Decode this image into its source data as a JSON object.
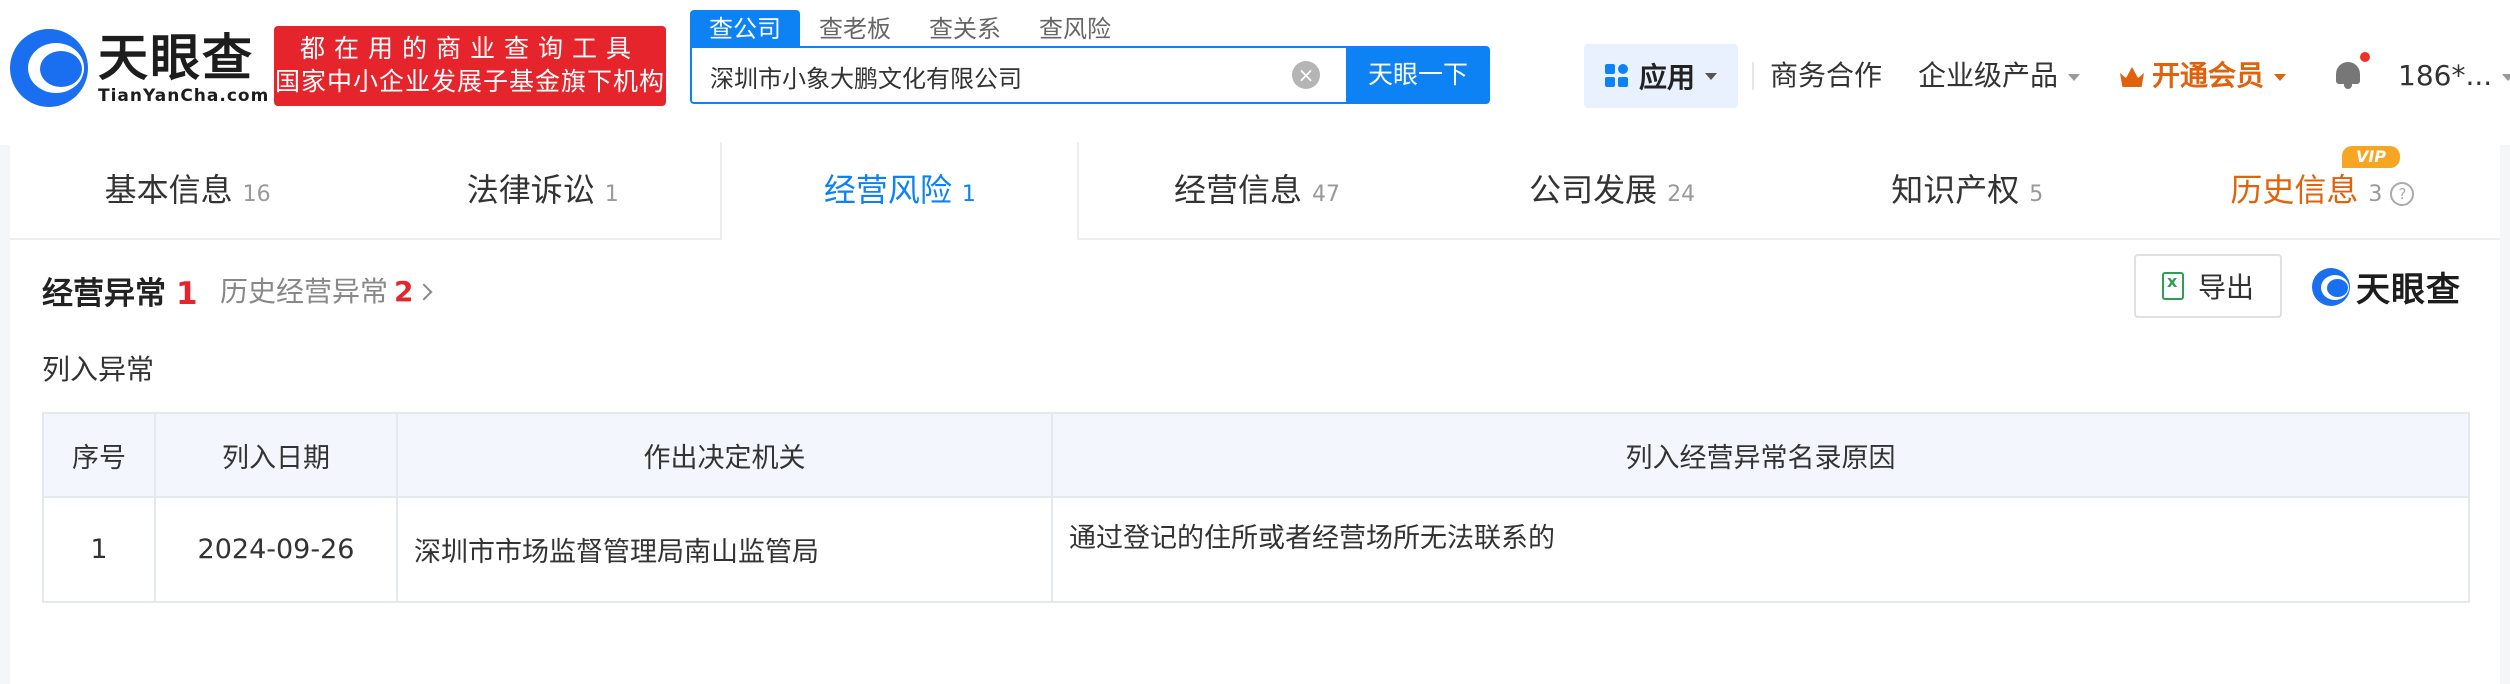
{
  "header": {
    "logo": {
      "cn": "天眼查",
      "en": "TianYanCha.com"
    },
    "promo": {
      "line1": "都在用的商业查询工具",
      "line2": "国家中小企业发展子基金旗下机构"
    },
    "search": {
      "tabs": [
        "查公司",
        "查老板",
        "查关系",
        "查风险"
      ],
      "active_tab": "查公司",
      "value": "深圳市小象大鹏文化有限公司",
      "button": "天眼一下"
    },
    "nav": {
      "apps": "应用",
      "business": "商务合作",
      "enterprise": "企业级产品",
      "vip": "开通会员",
      "user": "186*..."
    }
  },
  "tabs": [
    {
      "label": "基本信息",
      "count": "16"
    },
    {
      "label": "法律诉讼",
      "count": "1"
    },
    {
      "label": "经营风险",
      "count": "1"
    },
    {
      "label": "经营信息",
      "count": "47"
    },
    {
      "label": "公司发展",
      "count": "24"
    },
    {
      "label": "知识产权",
      "count": "5"
    },
    {
      "label": "历史信息",
      "count": "3"
    }
  ],
  "vip_badge": "VIP",
  "section": {
    "title": "经营异常",
    "count": "1",
    "history_label": "历史经营异常",
    "history_count": "2",
    "export": "导出",
    "brand": "天眼查",
    "subtitle": "列入异常"
  },
  "table": {
    "headers": [
      "序号",
      "列入日期",
      "作出决定机关",
      "列入经营异常名录原因"
    ],
    "rows": [
      [
        "1",
        "2024-09-26",
        "深圳市市场监督管理局南山监管局",
        "通过登记的住所或者经营场所无法联系的"
      ]
    ]
  },
  "colors": {
    "primary": "#0c82f5",
    "promo_red": "#e5242b",
    "vip_orange": "#e0620d"
  }
}
